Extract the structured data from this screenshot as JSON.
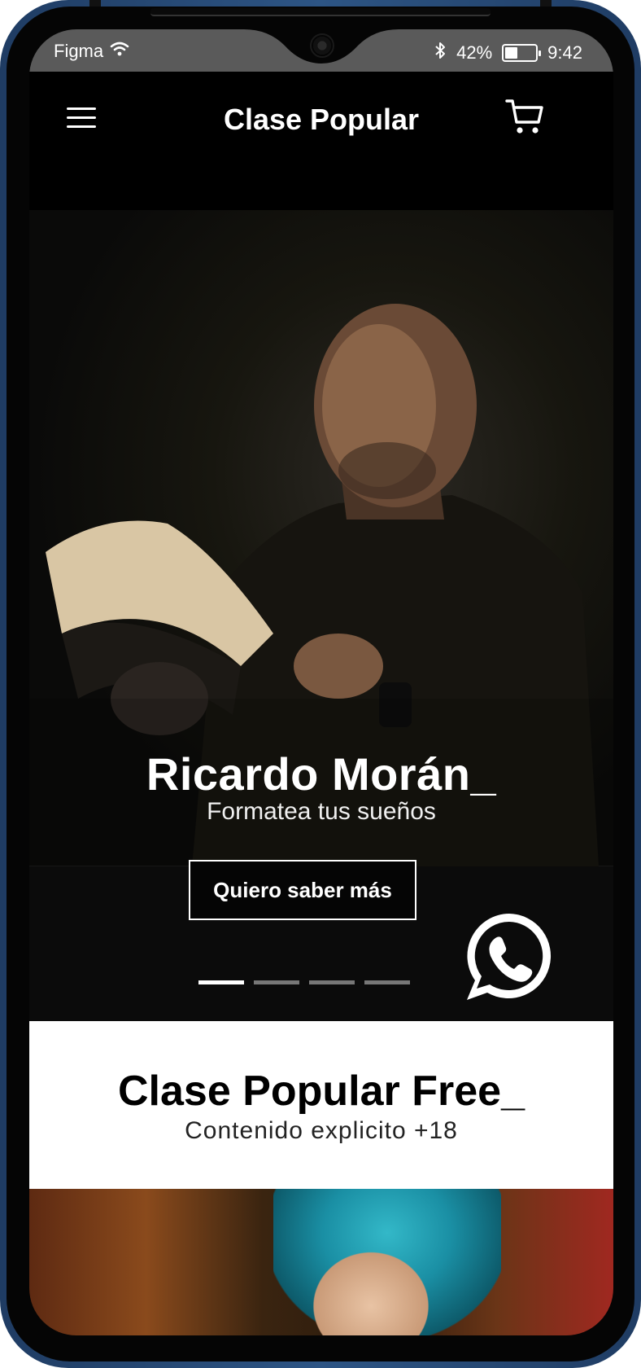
{
  "status_bar": {
    "carrier": "Figma",
    "battery": "42%",
    "battery_level": 0.42,
    "time": "9:42"
  },
  "header": {
    "title": "Clase Popular",
    "menu_icon": "hamburger-menu-icon",
    "cart_icon": "shopping-cart-icon"
  },
  "hero": {
    "title": "Ricardo Morán_",
    "subtitle": "Formatea tus sueños",
    "cta_label": "Quiero saber más",
    "slide_count": 4,
    "active_slide": 1,
    "whatsapp_icon": "whatsapp-icon"
  },
  "free_section": {
    "title": "Clase Popular Free_",
    "subtitle": "Contenido explicito +18"
  },
  "colors": {
    "header_bg": "#000000",
    "accent_text": "#ffffff",
    "frame": "#2d5585"
  }
}
